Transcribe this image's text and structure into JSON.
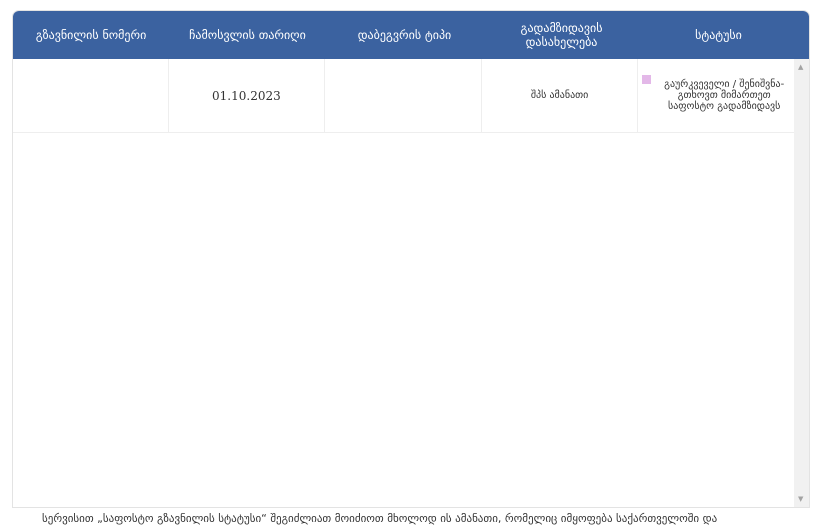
{
  "columns": [
    "გზავნილის ნომერი",
    "ჩამოსვლის თარიღი",
    "დაბეგვრის ტიპი",
    "გადამზიდავის დასახელება",
    "სტატუსი"
  ],
  "rows": [
    {
      "number": "",
      "date": "01.10.2023",
      "tax_type": "",
      "carrier": "შპს ამანათი",
      "status": "გაურკვეველი / შენიშვნა- გთხოვთ მიმართეთ საფოსტო გადამზიდავს",
      "status_color": "#e3b8e8"
    }
  ],
  "footer_text": "სერვისით „საფოსტო გზავნილის სტატუსი“ შეგიძლიათ მოიძიოთ მხოლოდ ის ამანათი, რომელიც იმყოფება საქართველოში და"
}
